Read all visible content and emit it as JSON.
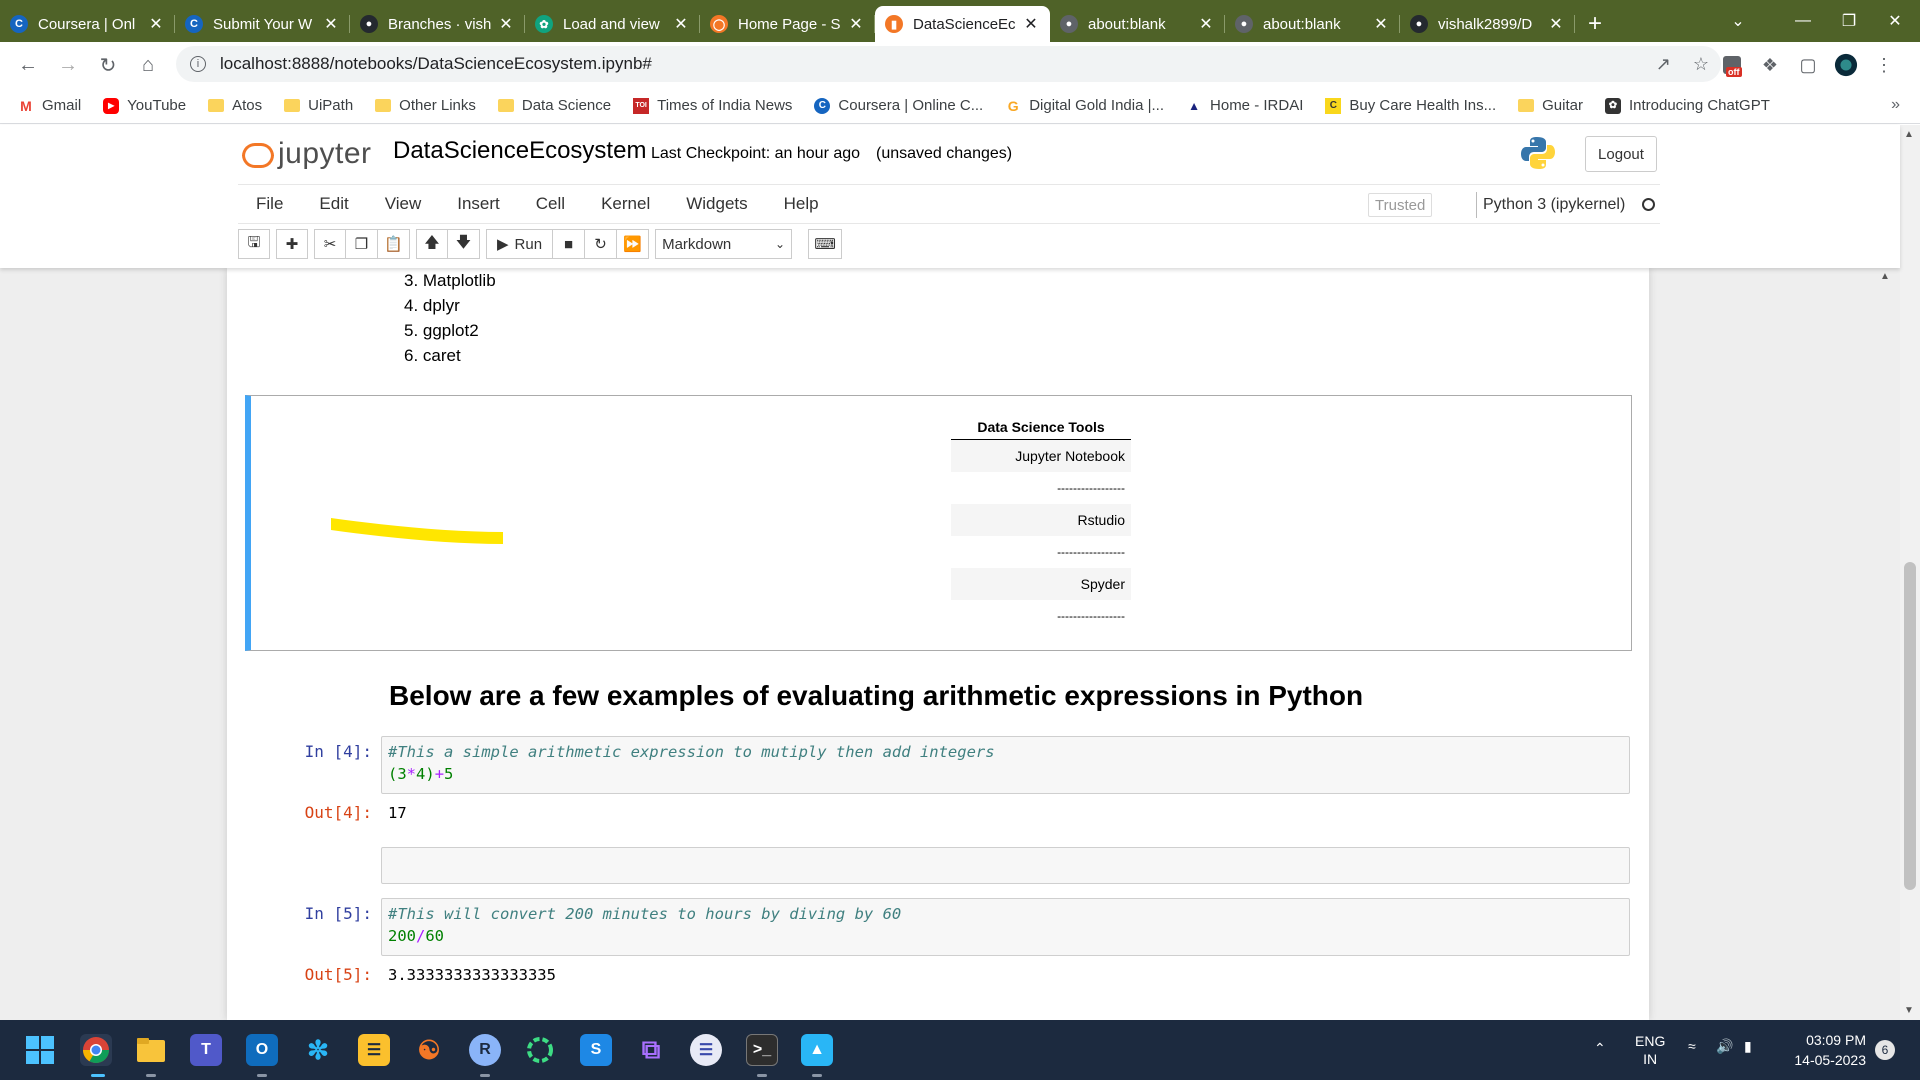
{
  "browser": {
    "tabs": [
      {
        "label": "Coursera | Onl",
        "icon": "coursera-icon",
        "color": "#1565c0",
        "active": false
      },
      {
        "label": "Submit Your W",
        "icon": "coursera-icon",
        "color": "#1565c0",
        "active": false
      },
      {
        "label": "Branches · vish",
        "icon": "github-icon",
        "color": "#24292f",
        "active": false
      },
      {
        "label": "Load and view",
        "icon": "chatgpt-icon",
        "color": "#10a37f",
        "active": false
      },
      {
        "label": "Home Page - S",
        "icon": "jupyter-icon",
        "color": "#f37726",
        "active": false
      },
      {
        "label": "DataScienceEc",
        "icon": "notebook-icon",
        "color": "#f37726",
        "active": true
      },
      {
        "label": "about:blank",
        "icon": "globe-icon",
        "color": "#5f6368",
        "active": false
      },
      {
        "label": "about:blank",
        "icon": "globe-icon",
        "color": "#5f6368",
        "active": false
      },
      {
        "label": "vishalk2899/D",
        "icon": "github-icon",
        "color": "#24292f",
        "active": false
      }
    ],
    "url": "localhost:8888/notebooks/DataScienceEcosystem.ipynb#",
    "bookmarks": [
      {
        "label": "Gmail",
        "icon": "gmail-icon"
      },
      {
        "label": "YouTube",
        "icon": "youtube-icon"
      },
      {
        "label": "Atos",
        "icon": "folder-icon"
      },
      {
        "label": "UiPath",
        "icon": "folder-icon"
      },
      {
        "label": "Other Links",
        "icon": "folder-icon"
      },
      {
        "label": "Data Science",
        "icon": "folder-icon"
      },
      {
        "label": "Times of India News",
        "icon": "toi-icon"
      },
      {
        "label": "Coursera | Online C...",
        "icon": "coursera-icon"
      },
      {
        "label": "Digital Gold India |...",
        "icon": "gold-icon"
      },
      {
        "label": "Home - IRDAI",
        "icon": "irdai-icon"
      },
      {
        "label": "Buy Care Health Ins...",
        "icon": "care-icon"
      },
      {
        "label": "Guitar",
        "icon": "folder-icon"
      },
      {
        "label": "Introducing ChatGPT",
        "icon": "chatgpt-icon"
      }
    ],
    "more_bookmarks": "»",
    "extension_badge": "off"
  },
  "jupyter": {
    "logo_text": "jupyter",
    "notebook_title": "DataScienceEcosystem",
    "checkpoint": "Last Checkpoint: an hour ago",
    "unsaved": "(unsaved changes)",
    "logout": "Logout",
    "menu": [
      "File",
      "Edit",
      "View",
      "Insert",
      "Cell",
      "Kernel",
      "Widgets",
      "Help"
    ],
    "trusted": "Trusted",
    "kernel": "Python 3 (ipykernel)",
    "run_label": "Run",
    "cell_type": "Markdown"
  },
  "notebook": {
    "list_items": [
      "3. Matplotlib",
      "4. dplyr",
      "5. ggplot2",
      "6. caret"
    ],
    "table": {
      "header": "Data Science Tools",
      "rows": [
        "Jupyter Notebook",
        "-----------------",
        "Rstudio",
        "-----------------",
        "Spyder",
        "-----------------"
      ]
    },
    "heading": "Below are a few examples of evaluating arithmetic expressions in Python",
    "cells": [
      {
        "in_prompt": "In [4]:",
        "comment": "#This a simple arithmetic expression to mutiply then add integers",
        "code": "(3*4)+5",
        "out_prompt": "Out[4]:",
        "output": "17"
      },
      {
        "in_prompt": "In [5]:",
        "comment": "#This will convert 200 minutes to hours by diving by 60",
        "code": "200/60",
        "out_prompt": "Out[5]:",
        "output": "3.3333333333333335"
      }
    ]
  },
  "taskbar": {
    "language": "ENG",
    "region": "IN",
    "time": "03:09 PM",
    "date": "14-05-2023",
    "notifications": "6"
  }
}
